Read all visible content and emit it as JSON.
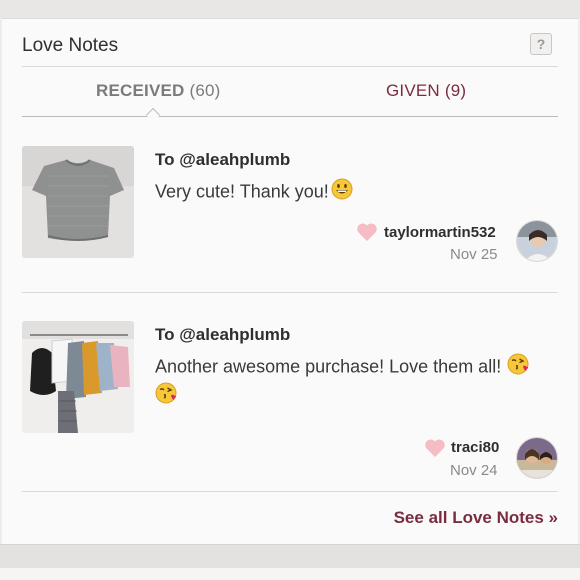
{
  "header": {
    "title": "Love Notes",
    "help_label": "?"
  },
  "tabs": [
    {
      "name": "RECEIVED",
      "count": "(60)",
      "active": true
    },
    {
      "name": "GIVEN",
      "count": "(9)",
      "active": false
    }
  ],
  "notes": [
    {
      "to": "To @aleahplumb",
      "message": "Very cute! Thank you!",
      "emojis": [
        "grinning-face"
      ],
      "giver": "taylormartin532",
      "date": "Nov 25"
    },
    {
      "to": "To @aleahplumb",
      "message": "Another awesome purchase! Love them all!",
      "emojis": [
        "face-blowing-kiss",
        "face-blowing-kiss"
      ],
      "giver": "traci80",
      "date": "Nov 24"
    }
  ],
  "footer": {
    "see_all": "See all Love Notes »"
  },
  "colors": {
    "accent": "#7a2d3f",
    "heart": "#f4b8c0",
    "card_bg": "#fbfafa",
    "page_bg": "#eeecea"
  }
}
